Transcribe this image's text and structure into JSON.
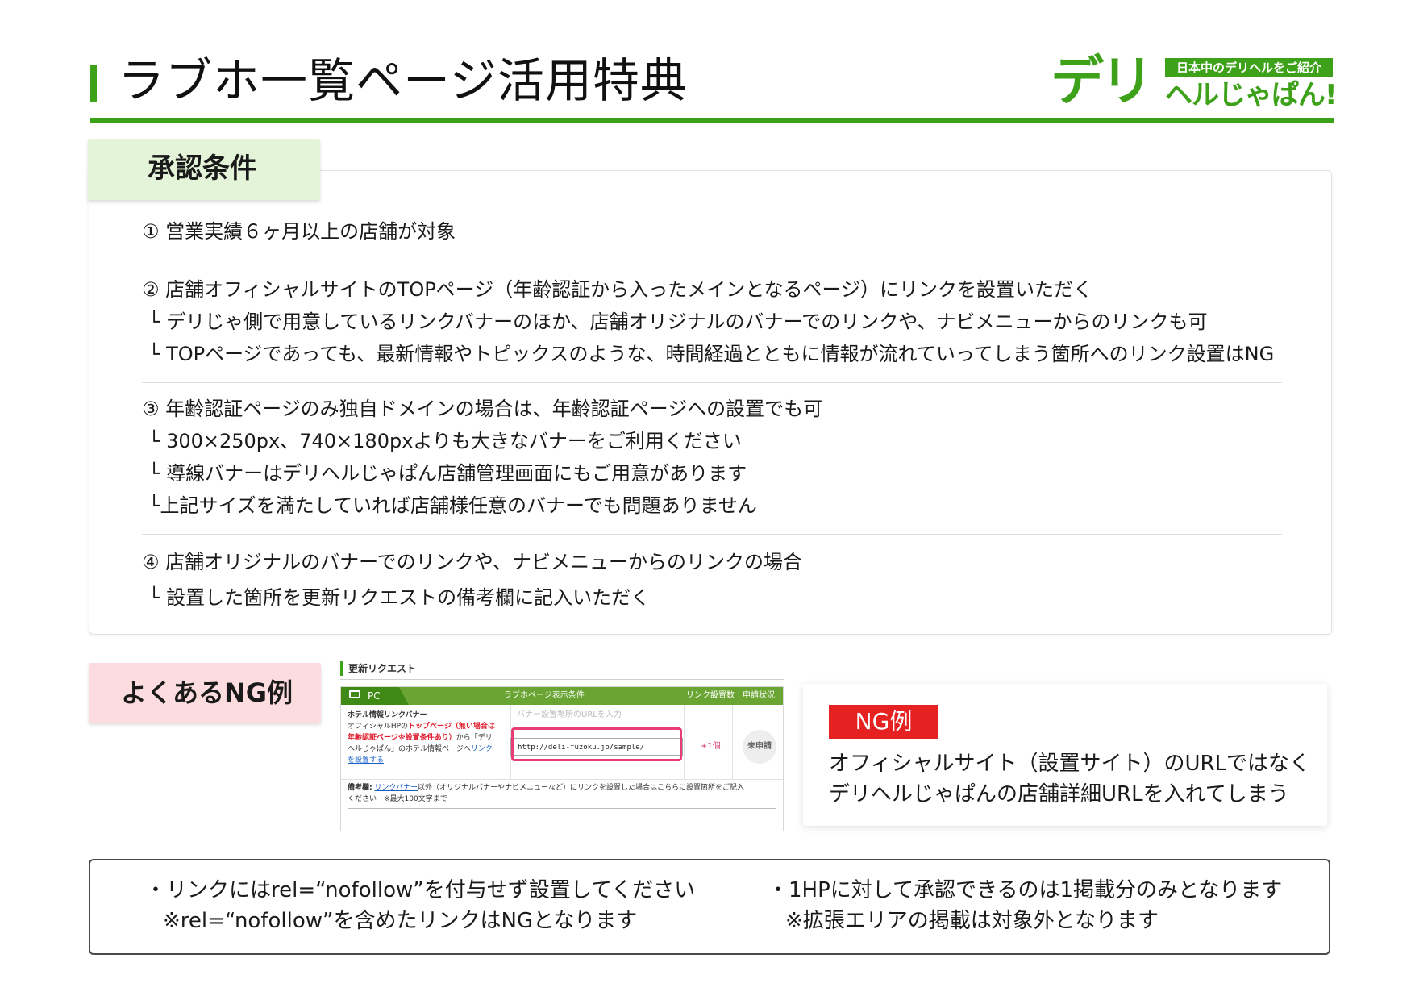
{
  "header": {
    "title": "ラブホ一覧ページ活用特典"
  },
  "logo": {
    "big": "デリ",
    "tag": "日本中のデリヘルをご紹介",
    "sub": "ヘルじゃぱん!"
  },
  "conditions": {
    "tab_label": "承認条件",
    "sections": [
      {
        "lines": [
          "① 営業実績６ヶ月以上の店舗が対象"
        ]
      },
      {
        "lines": [
          "② 店舗オフィシャルサイトのTOPページ（年齢認証から入ったメインとなるページ）にリンクを設置いただく",
          "└ デリじゃ側で用意しているリンクバナーのほか、店舗オリジナルのバナーでのリンクや、ナビメニューからのリンクも可",
          "└ TOPページであっても、最新情報やトピックスのような、時間経過とともに情報が流れていってしまう箇所へのリンク設置はNG"
        ]
      },
      {
        "lines": [
          "③ 年齢認証ページのみ独自ドメインの場合は、年齢認証ページへの設置でも可",
          "└ 300×250px、740×180pxよりも大きなバナーをご利用ください",
          "└ 導線バナーはデリヘルじゃぱん店舗管理画面にもご用意があります",
          "└上記サイズを満たしていれば店舗様任意のバナーでも問題ありません"
        ]
      },
      {
        "lines": [
          "④ 店舗オリジナルのバナーでのリンクや、ナビメニューからのリンクの場合",
          "└ 設置した箇所を更新リクエストの備考欄に記入いただく"
        ]
      }
    ]
  },
  "ng_section": {
    "tab_label": "よくあるNG例",
    "screenshot": {
      "heading": "更新リクエスト",
      "pc_label": "PC",
      "col_condition": "ラブホページ表示条件",
      "col_count": "リンク設置数",
      "col_status": "申請状況",
      "banner_title": "ホテル情報リンクバナー",
      "desc_1": "オフィシャルHPの",
      "desc_red_1": "トップページ（無い場合は",
      "desc_red_2": "年齢認証ページ※設置条件あり）",
      "desc_2": "から「デリ",
      "desc_3": "ヘルじゃぱん」のホテル情報ページへ",
      "desc_link_1": "リンク",
      "desc_link_2": "を設置する",
      "blurred": "バナー設置場所のURLを入力",
      "url_value": "http://deli-fuzoku.jp/sample/",
      "count_value": "+1個",
      "status_value": "未申請",
      "memo_label": "備考欄:",
      "memo_link": "リンクバナー",
      "memo_text": "以外（オリジナルバナーやナビメニューなど）にリンクを設置した場合はこちらに設置箇所をご記入",
      "memo_text_2": "ください　※最大100文字まで"
    },
    "card": {
      "badge": "NG例",
      "line_1": "オフィシャルサイト（設置サイト）のURLではなく",
      "line_2": "デリヘルじゃぱんの店舗詳細URLを入れてしまう"
    }
  },
  "notes": {
    "left_1": "・リンクにはrel=“nofollow”を付与せず設置してください",
    "left_2": "※rel=“nofollow”を含めたリンクはNGとなります",
    "right_1": "・1HPに対して承認できるのは1掲載分のみとなります",
    "right_2": "※拡張エリアの掲載は対象外となります"
  },
  "colors": {
    "accent_green": "#3da11a",
    "tab_green_bg": "#e4f4d9",
    "tab_pink_bg": "#fcdcde",
    "ng_red": "#e52121",
    "highlight_pink": "#e83e73"
  }
}
